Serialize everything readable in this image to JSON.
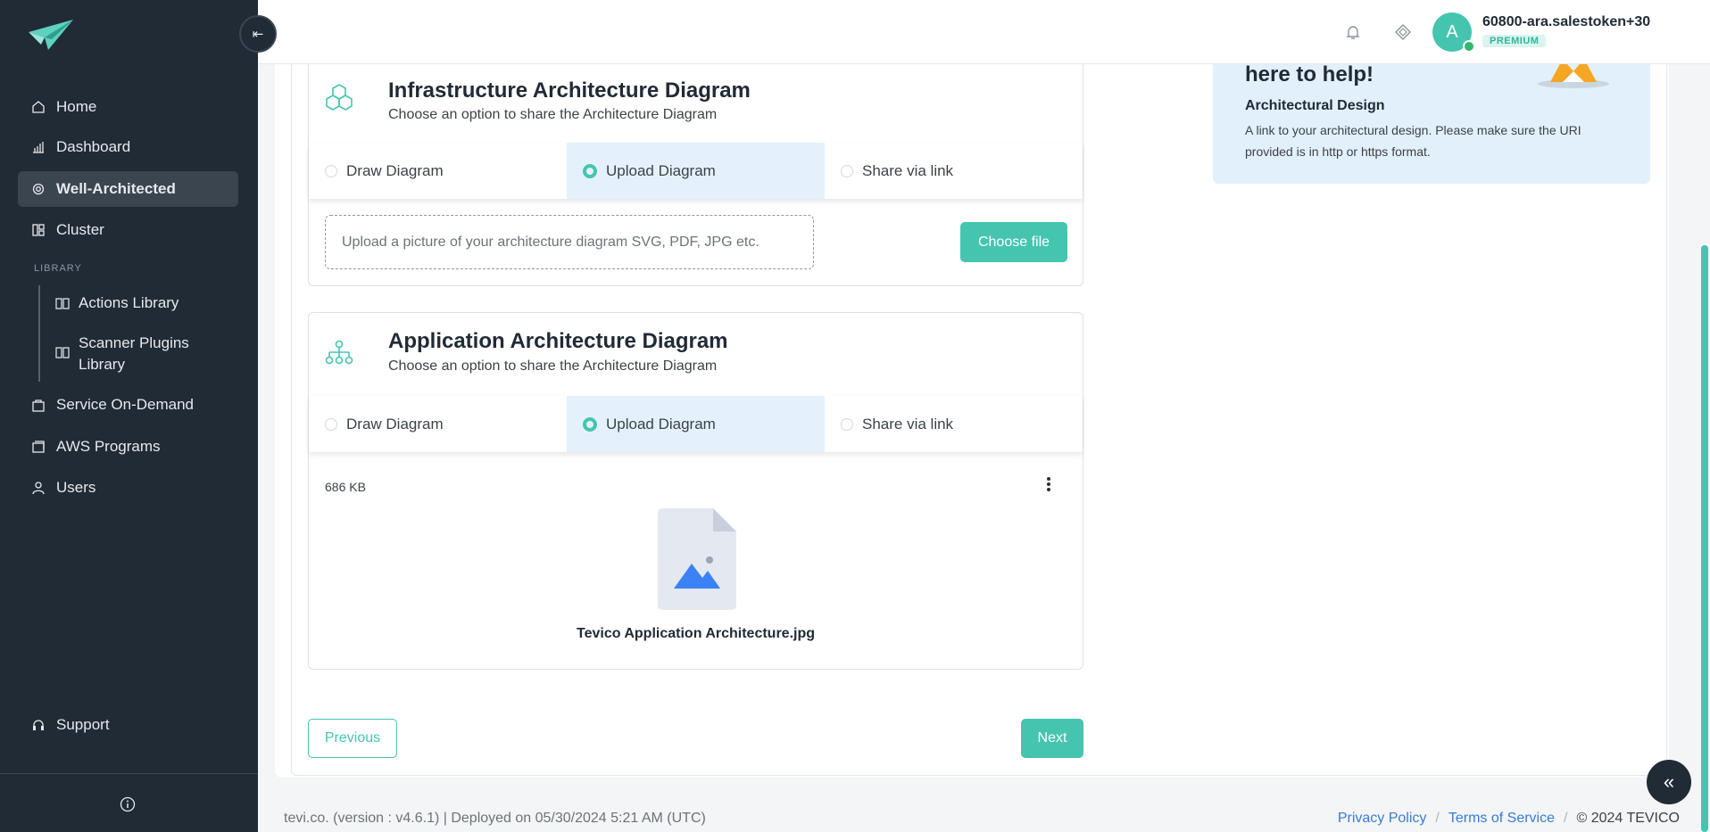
{
  "sidebar": {
    "nav": [
      {
        "label": "Home",
        "icon": "home-icon"
      },
      {
        "label": "Dashboard",
        "icon": "chart-icon"
      },
      {
        "label": "Well-Architected",
        "icon": "gear-icon",
        "active": true
      },
      {
        "label": "Cluster",
        "icon": "grid-icon"
      }
    ],
    "library_label": "LIBRARY",
    "library": [
      {
        "label": "Actions Library",
        "icon": "book-icon"
      },
      {
        "label": "Scanner Plugins Library",
        "icon": "book-icon"
      }
    ],
    "nav2": [
      {
        "label": "Service On-Demand",
        "icon": "bag-icon"
      },
      {
        "label": "AWS Programs",
        "icon": "cards-icon"
      },
      {
        "label": "Users",
        "icon": "user-icon"
      }
    ],
    "support": "Support",
    "collapse_glyph": "⇤"
  },
  "header": {
    "avatar_letter": "A",
    "user_name": "60800-ara.salestoken+30",
    "badge": "PREMIUM"
  },
  "infra": {
    "title": "Infrastructure Architecture Diagram",
    "subtitle": "Choose an option to share the Architecture Diagram",
    "options": [
      "Draw Diagram",
      "Upload Diagram",
      "Share via link"
    ],
    "selected": "Upload Diagram",
    "upload_placeholder": "Upload a picture of your architecture diagram SVG, PDF, JPG etc.",
    "choose_file": "Choose file"
  },
  "app": {
    "title": "Application Architecture Diagram",
    "subtitle": "Choose an option to share the Architecture Diagram",
    "options": [
      "Draw Diagram",
      "Upload Diagram",
      "Share via link"
    ],
    "selected": "Upload Diagram",
    "file_size": "686 KB",
    "file_name": "Tevico Application Architecture.jpg"
  },
  "nav_buttons": {
    "previous": "Previous",
    "next": "Next"
  },
  "help": {
    "title": "here to help!",
    "subtitle": "Architectural Design",
    "text": "A link to your architectural design. Please make sure the URI provided is in http or https format."
  },
  "footer": {
    "left": "tevi.co. (version : v4.6.1) | Deployed on 05/30/2024 5:21 AM (UTC)",
    "privacy": "Privacy Policy",
    "terms": "Terms of Service",
    "sep": "/",
    "copyright": "© 2024 TEVICO"
  },
  "scroll_fab_glyph": "«",
  "colors": {
    "accent": "#45c5b0",
    "sidebar": "#212b36",
    "link": "#3a7bd5",
    "help_bg": "#e2f0fc"
  }
}
